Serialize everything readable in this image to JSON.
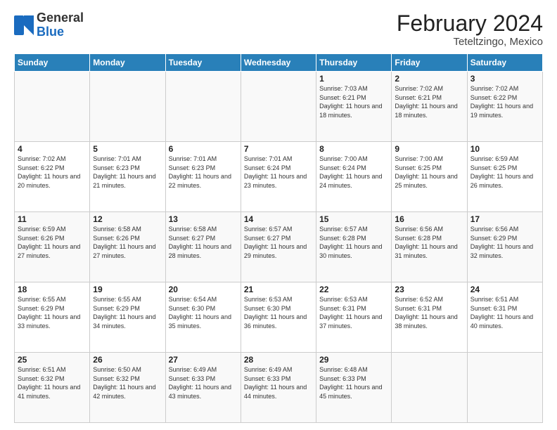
{
  "logo": {
    "general": "General",
    "blue": "Blue"
  },
  "title": "February 2024",
  "location": "Teteltzingo, Mexico",
  "days_of_week": [
    "Sunday",
    "Monday",
    "Tuesday",
    "Wednesday",
    "Thursday",
    "Friday",
    "Saturday"
  ],
  "weeks": [
    [
      {
        "day": "",
        "sunrise": "",
        "sunset": "",
        "daylight": ""
      },
      {
        "day": "",
        "sunrise": "",
        "sunset": "",
        "daylight": ""
      },
      {
        "day": "",
        "sunrise": "",
        "sunset": "",
        "daylight": ""
      },
      {
        "day": "",
        "sunrise": "",
        "sunset": "",
        "daylight": ""
      },
      {
        "day": "1",
        "sunrise": "7:03 AM",
        "sunset": "6:21 PM",
        "daylight": "11 hours and 18 minutes."
      },
      {
        "day": "2",
        "sunrise": "7:02 AM",
        "sunset": "6:21 PM",
        "daylight": "11 hours and 18 minutes."
      },
      {
        "day": "3",
        "sunrise": "7:02 AM",
        "sunset": "6:22 PM",
        "daylight": "11 hours and 19 minutes."
      }
    ],
    [
      {
        "day": "4",
        "sunrise": "7:02 AM",
        "sunset": "6:22 PM",
        "daylight": "11 hours and 20 minutes."
      },
      {
        "day": "5",
        "sunrise": "7:01 AM",
        "sunset": "6:23 PM",
        "daylight": "11 hours and 21 minutes."
      },
      {
        "day": "6",
        "sunrise": "7:01 AM",
        "sunset": "6:23 PM",
        "daylight": "11 hours and 22 minutes."
      },
      {
        "day": "7",
        "sunrise": "7:01 AM",
        "sunset": "6:24 PM",
        "daylight": "11 hours and 23 minutes."
      },
      {
        "day": "8",
        "sunrise": "7:00 AM",
        "sunset": "6:24 PM",
        "daylight": "11 hours and 24 minutes."
      },
      {
        "day": "9",
        "sunrise": "7:00 AM",
        "sunset": "6:25 PM",
        "daylight": "11 hours and 25 minutes."
      },
      {
        "day": "10",
        "sunrise": "6:59 AM",
        "sunset": "6:25 PM",
        "daylight": "11 hours and 26 minutes."
      }
    ],
    [
      {
        "day": "11",
        "sunrise": "6:59 AM",
        "sunset": "6:26 PM",
        "daylight": "11 hours and 27 minutes."
      },
      {
        "day": "12",
        "sunrise": "6:58 AM",
        "sunset": "6:26 PM",
        "daylight": "11 hours and 27 minutes."
      },
      {
        "day": "13",
        "sunrise": "6:58 AM",
        "sunset": "6:27 PM",
        "daylight": "11 hours and 28 minutes."
      },
      {
        "day": "14",
        "sunrise": "6:57 AM",
        "sunset": "6:27 PM",
        "daylight": "11 hours and 29 minutes."
      },
      {
        "day": "15",
        "sunrise": "6:57 AM",
        "sunset": "6:28 PM",
        "daylight": "11 hours and 30 minutes."
      },
      {
        "day": "16",
        "sunrise": "6:56 AM",
        "sunset": "6:28 PM",
        "daylight": "11 hours and 31 minutes."
      },
      {
        "day": "17",
        "sunrise": "6:56 AM",
        "sunset": "6:29 PM",
        "daylight": "11 hours and 32 minutes."
      }
    ],
    [
      {
        "day": "18",
        "sunrise": "6:55 AM",
        "sunset": "6:29 PM",
        "daylight": "11 hours and 33 minutes."
      },
      {
        "day": "19",
        "sunrise": "6:55 AM",
        "sunset": "6:29 PM",
        "daylight": "11 hours and 34 minutes."
      },
      {
        "day": "20",
        "sunrise": "6:54 AM",
        "sunset": "6:30 PM",
        "daylight": "11 hours and 35 minutes."
      },
      {
        "day": "21",
        "sunrise": "6:53 AM",
        "sunset": "6:30 PM",
        "daylight": "11 hours and 36 minutes."
      },
      {
        "day": "22",
        "sunrise": "6:53 AM",
        "sunset": "6:31 PM",
        "daylight": "11 hours and 37 minutes."
      },
      {
        "day": "23",
        "sunrise": "6:52 AM",
        "sunset": "6:31 PM",
        "daylight": "11 hours and 38 minutes."
      },
      {
        "day": "24",
        "sunrise": "6:51 AM",
        "sunset": "6:31 PM",
        "daylight": "11 hours and 40 minutes."
      }
    ],
    [
      {
        "day": "25",
        "sunrise": "6:51 AM",
        "sunset": "6:32 PM",
        "daylight": "11 hours and 41 minutes."
      },
      {
        "day": "26",
        "sunrise": "6:50 AM",
        "sunset": "6:32 PM",
        "daylight": "11 hours and 42 minutes."
      },
      {
        "day": "27",
        "sunrise": "6:49 AM",
        "sunset": "6:33 PM",
        "daylight": "11 hours and 43 minutes."
      },
      {
        "day": "28",
        "sunrise": "6:49 AM",
        "sunset": "6:33 PM",
        "daylight": "11 hours and 44 minutes."
      },
      {
        "day": "29",
        "sunrise": "6:48 AM",
        "sunset": "6:33 PM",
        "daylight": "11 hours and 45 minutes."
      },
      {
        "day": "",
        "sunrise": "",
        "sunset": "",
        "daylight": ""
      },
      {
        "day": "",
        "sunrise": "",
        "sunset": "",
        "daylight": ""
      }
    ]
  ],
  "labels": {
    "sunrise_prefix": "Sunrise: ",
    "sunset_prefix": "Sunset: ",
    "daylight_prefix": "Daylight: "
  }
}
